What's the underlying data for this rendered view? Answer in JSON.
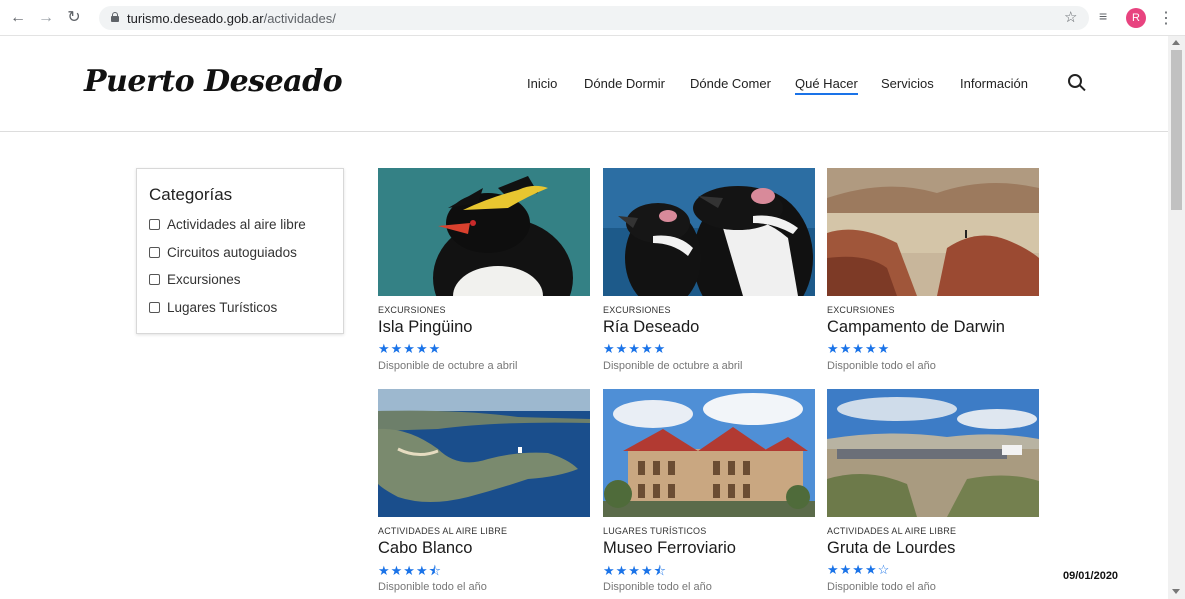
{
  "browser": {
    "url_domain": "turismo.deseado.gob.ar",
    "url_path": "/actividades/",
    "avatar_letter": "R",
    "icons": [
      "back-arrow-icon",
      "forward-arrow-icon",
      "reload-icon",
      "lock-icon",
      "star-icon",
      "media-icon",
      "more-icon"
    ]
  },
  "site": {
    "logo": "Puerto Deseado",
    "nav": [
      "Inicio",
      "Dónde Dormir",
      "Dónde Comer",
      "Qué Hacer",
      "Servicios",
      "Información"
    ],
    "active_nav": "Qué Hacer"
  },
  "sidebar": {
    "title": "Categorías",
    "categories": [
      "Actividades al aire libre",
      "Circuitos autoguiados",
      "Excursiones",
      "Lugares Turísticos"
    ]
  },
  "cards": [
    {
      "tag": "EXCURSIONES",
      "title": "Isla Pingüino",
      "rating": 5,
      "stars": "★★★★★",
      "availability": "Disponible de octubre a abril"
    },
    {
      "tag": "EXCURSIONES",
      "title": "Ría Deseado",
      "rating": 5,
      "stars": "★★★★★",
      "availability": "Disponible de octubre a abril"
    },
    {
      "tag": "EXCURSIONES",
      "title": "Campamento de Darwin",
      "rating": 5,
      "stars": "★★★★★",
      "availability": "Disponible todo el año"
    },
    {
      "tag": "ACTIVIDADES AL AIRE LIBRE",
      "title": "Cabo Blanco",
      "rating": 4.5,
      "stars": "★★★★⯪",
      "availability": "Disponible todo el año"
    },
    {
      "tag": "LUGARES TURÍSTICOS",
      "title": "Museo Ferroviario",
      "rating": 4.5,
      "stars": "★★★★⯪",
      "availability": "Disponible todo el año"
    },
    {
      "tag": "ACTIVIDADES AL AIRE LIBRE",
      "title": "Gruta de Lourdes",
      "rating": 4,
      "stars": "★★★★☆",
      "availability": "Disponible todo el año"
    }
  ],
  "date_stamp": "09/01/2020",
  "colors": {
    "accent": "#1a73e8",
    "star": "#1a73e8"
  }
}
